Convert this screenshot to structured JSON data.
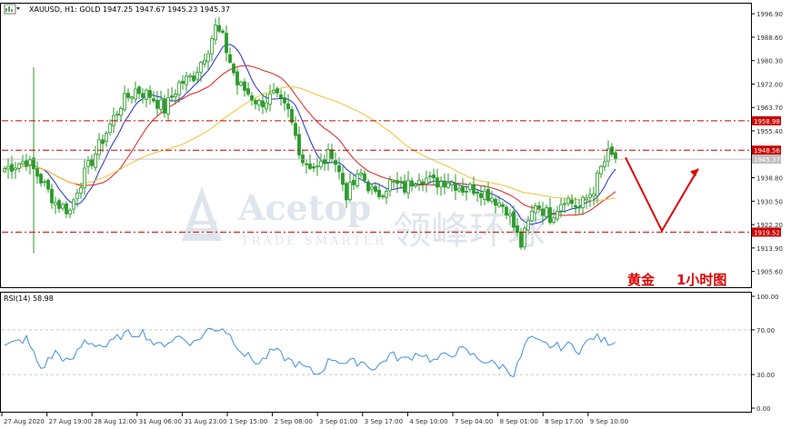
{
  "header": {
    "symbol_info": "XAUUSD, H1:  GOLD  1947.25 1947.67 1945.23 1945.37",
    "current_price_label": "1945.37"
  },
  "annotation": {
    "title_cn": "黄金",
    "timeframe_cn": "1小时图"
  },
  "watermark": {
    "brand": "Acetop",
    "tagline": "TRADE SMARTER",
    "cn": "领峰环球"
  },
  "colors": {
    "up_candle": "#2a9a2a",
    "down_candle": "#2a9a2a",
    "ma_fast": "#1f2fd0",
    "ma_mid": "#e02020",
    "ma_slow": "#f2c230",
    "level_line": "#cc0000",
    "rsi_line": "#3f8fe0",
    "arrow": "#e00000",
    "grid": "#c8c8c8",
    "axis_text": "#303030"
  },
  "chart_data": [
    {
      "type": "candlestick",
      "title": "XAUUSD, H1",
      "price_axis": {
        "ylim": [
          1900.0,
          2000.5
        ],
        "ticks": [
          "1996.90",
          "1988.60",
          "1980.30",
          "1972.00",
          "1963.70",
          "1955.40",
          "1938.80",
          "1930.50",
          "1922.20",
          "1913.90",
          "1905.60"
        ]
      },
      "x_tick_labels": [
        "27 Aug 2020",
        "27 Aug 19:00",
        "28 Aug 12:00",
        "31 Aug 06:00",
        "31 Aug 23:00",
        "1 Sep 15:00",
        "2 Sep 08:00",
        "3 Sep 01:00",
        "3 Sep 17:00",
        "4 Sep 10:00",
        "7 Sep 04:00",
        "8 Sep 01:00",
        "8 Sep 17:00",
        "9 Sep 10:00"
      ],
      "horizontal_levels": [
        {
          "label": "1958.98",
          "value": 1958.98
        },
        {
          "label": "1948.56",
          "value": 1948.56
        },
        {
          "label": "1919.52",
          "value": 1919.52
        }
      ],
      "current_price": 1945.37,
      "close_anchors": [
        [
          0,
          1942
        ],
        [
          6,
          1945
        ],
        [
          10,
          1938
        ],
        [
          14,
          1930
        ],
        [
          18,
          1927
        ],
        [
          20,
          1935
        ],
        [
          26,
          1950
        ],
        [
          32,
          1965
        ],
        [
          36,
          1970
        ],
        [
          40,
          1968
        ],
        [
          44,
          1963
        ],
        [
          48,
          1972
        ],
        [
          52,
          1975
        ],
        [
          56,
          1985
        ],
        [
          58,
          1992
        ],
        [
          60,
          1988
        ],
        [
          64,
          1972
        ],
        [
          66,
          1970
        ],
        [
          70,
          1965
        ],
        [
          74,
          1968
        ],
        [
          78,
          1962
        ],
        [
          82,
          1945
        ],
        [
          86,
          1942
        ],
        [
          90,
          1948
        ],
        [
          94,
          1933
        ],
        [
          98,
          1940
        ],
        [
          102,
          1932
        ],
        [
          106,
          1937
        ],
        [
          110,
          1935
        ],
        [
          114,
          1940
        ],
        [
          118,
          1937
        ],
        [
          122,
          1938
        ],
        [
          126,
          1935
        ],
        [
          130,
          1935
        ],
        [
          134,
          1932
        ],
        [
          138,
          1928
        ],
        [
          142,
          1915
        ],
        [
          146,
          1930
        ],
        [
          150,
          1925
        ],
        [
          154,
          1932
        ],
        [
          158,
          1928
        ],
        [
          162,
          1935
        ],
        [
          164,
          1942
        ],
        [
          166,
          1947
        ],
        [
          168,
          1945.37
        ]
      ],
      "projection": {
        "description_points": [
          [
            1946,
            0
          ],
          [
            1920,
            1
          ],
          [
            1942,
            2
          ]
        ]
      }
    },
    {
      "type": "line",
      "title": "RSI(14) 58.98",
      "ylim": [
        0,
        100
      ],
      "ticks": [
        "100.00",
        "70.00",
        "30.00",
        "0.00"
      ],
      "levels": [
        70,
        30
      ],
      "rsi_anchors": [
        [
          0,
          55
        ],
        [
          6,
          62
        ],
        [
          10,
          35
        ],
        [
          14,
          50
        ],
        [
          18,
          40
        ],
        [
          22,
          60
        ],
        [
          28,
          55
        ],
        [
          32,
          65
        ],
        [
          38,
          68
        ],
        [
          42,
          55
        ],
        [
          48,
          64
        ],
        [
          52,
          58
        ],
        [
          56,
          70
        ],
        [
          60,
          72
        ],
        [
          62,
          65
        ],
        [
          66,
          48
        ],
        [
          70,
          40
        ],
        [
          74,
          52
        ],
        [
          78,
          43
        ],
        [
          82,
          37
        ],
        [
          86,
          30
        ],
        [
          90,
          45
        ],
        [
          94,
          40
        ],
        [
          98,
          42
        ],
        [
          102,
          35
        ],
        [
          106,
          48
        ],
        [
          110,
          43
        ],
        [
          114,
          50
        ],
        [
          118,
          42
        ],
        [
          122,
          48
        ],
        [
          126,
          52
        ],
        [
          130,
          45
        ],
        [
          134,
          40
        ],
        [
          138,
          36
        ],
        [
          140,
          30
        ],
        [
          144,
          62
        ],
        [
          148,
          57
        ],
        [
          152,
          55
        ],
        [
          156,
          56
        ],
        [
          158,
          52
        ],
        [
          162,
          64
        ],
        [
          165,
          60
        ],
        [
          168,
          58.98
        ]
      ]
    }
  ]
}
